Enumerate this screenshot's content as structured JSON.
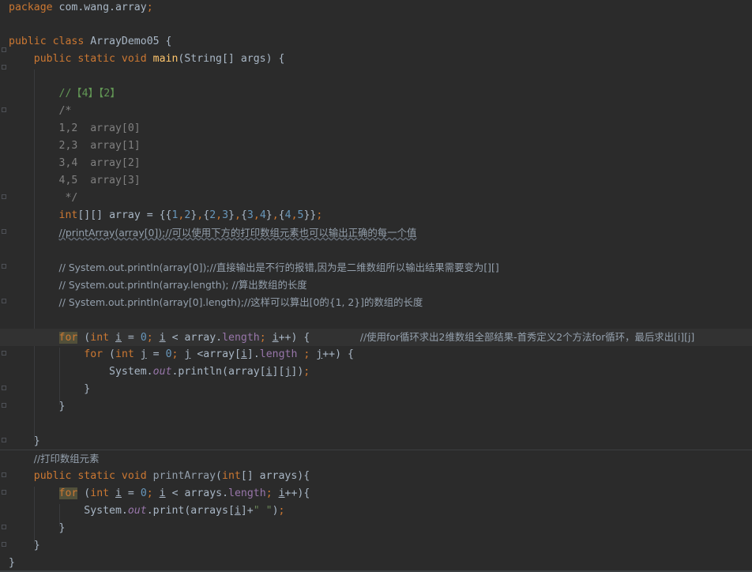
{
  "code": {
    "package": "com.wang.array",
    "class_name": "ArrayDemo05",
    "main_method": "main",
    "main_param_type": "String[]",
    "main_param": "args",
    "comment_tag": "//【4】【2】",
    "block_open": "/*",
    "block_line1": "1,2  array[0]",
    "block_line2": "2,3  array[1]",
    "block_line3": "3,4  array[2]",
    "block_line4": "4,5  array[3]",
    "block_close": " */",
    "array_var": "array",
    "v1": "1",
    "v2": "2",
    "v3": "2",
    "v4": "3",
    "v5": "3",
    "v6": "4",
    "v7": "4",
    "v8": "5",
    "comment_print": "//printArray(array[0]);//可以使用下方的打印数组元素也可以输出正确的每一个值",
    "comment_sys1": "// System.out.println(array[0]);//直接输出是不行的报错,因为是二维数组所以输出结果需要变为[][]",
    "comment_sys2": "// System.out.println(array.length); //算出数组的长度",
    "comment_sys3": "// System.out.println(array[0].length);//这样可以算出[0的{1, 2}]的数组的长度",
    "for_kw": "for",
    "int_kw": "int",
    "i_var": "i",
    "j_var": "j",
    "zero": "0",
    "length_field": "length",
    "for_comment": "//使用for循环求出2维数组全部结果-首秀定义2个方法for循环，最后求出[i][j]",
    "out_field": "out",
    "println_text": "println",
    "print_text": "print",
    "print_comment": "//打印数组元素",
    "print_method": "printArray",
    "print_param": "arrays",
    "space_str": "\" \""
  },
  "colors": {
    "background": "#2b2b2b",
    "keyword": "#cc7832",
    "method": "#ffc66d",
    "number": "#6897bb",
    "string": "#6a8759",
    "comment": "#808080",
    "doc_comment": "#629755",
    "field": "#9876aa",
    "text": "#a9b7c6"
  }
}
